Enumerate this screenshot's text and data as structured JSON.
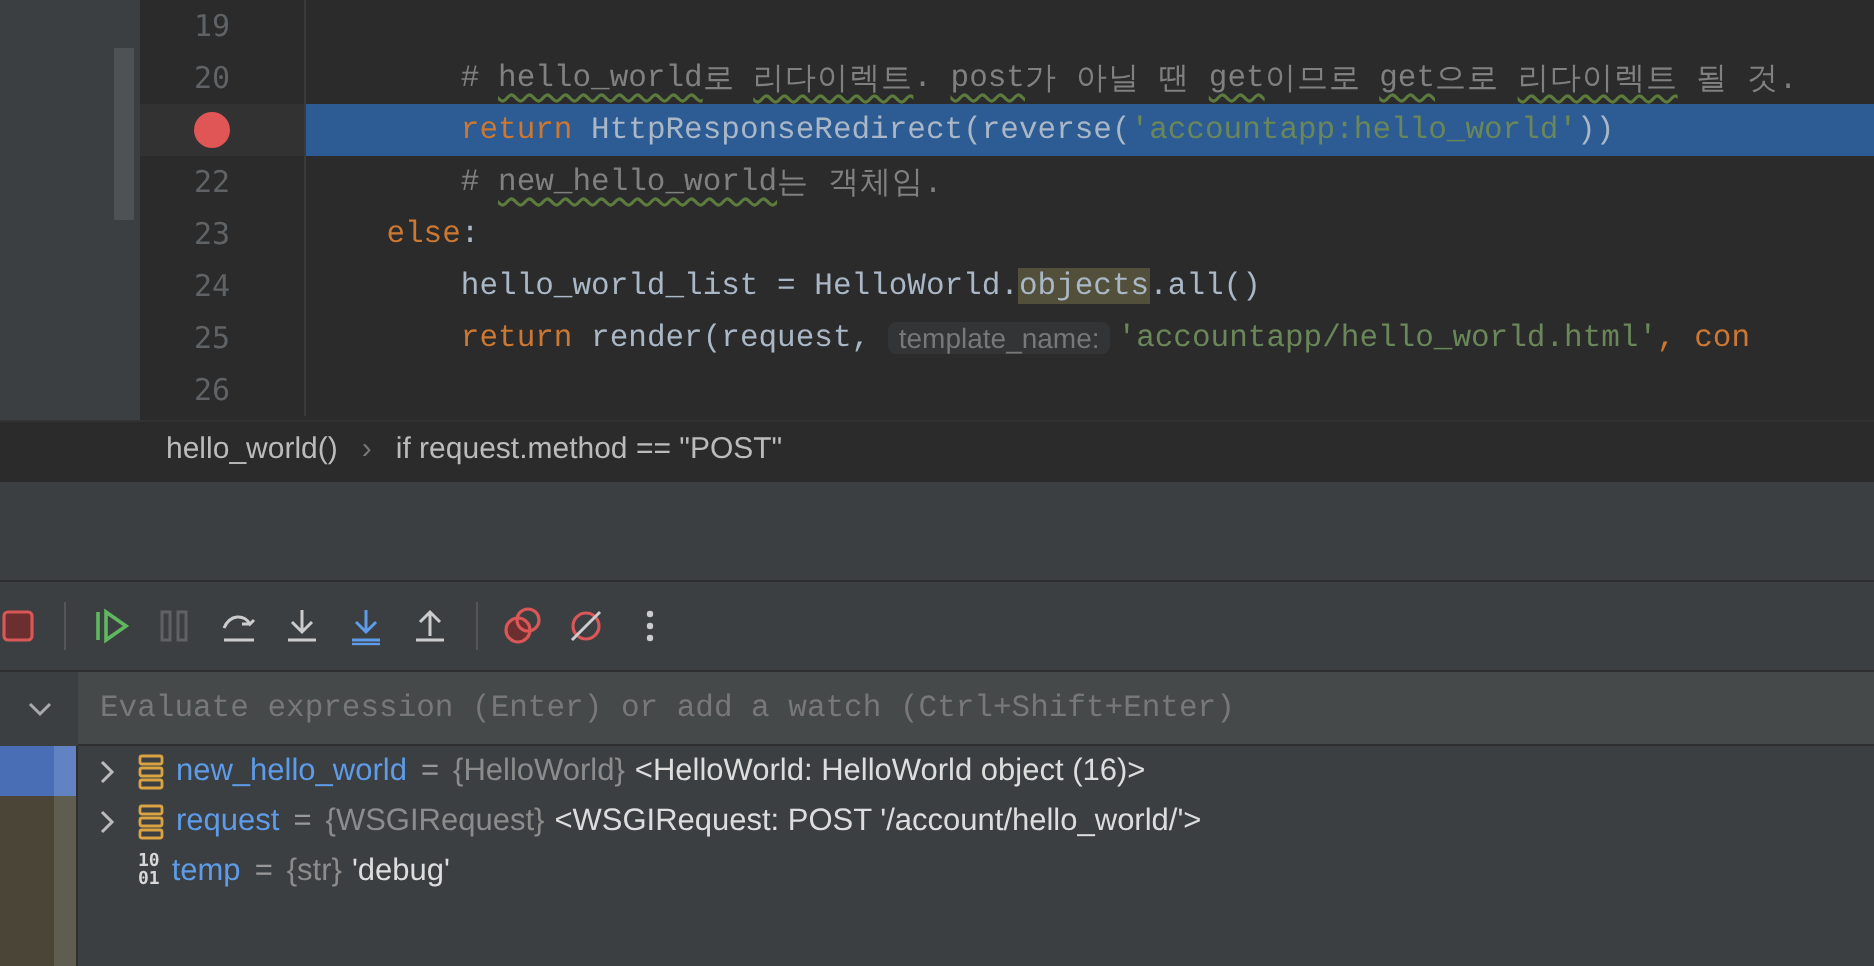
{
  "editor": {
    "lines": [
      {
        "number": "19",
        "breakpoint": false,
        "highlighted": false
      },
      {
        "number": "20",
        "breakpoint": false,
        "highlighted": false,
        "tokens": [
          {
            "text": "        # ",
            "kind": "comment"
          },
          {
            "text": "hello_world",
            "kind": "typo"
          },
          {
            "text": "로 ",
            "kind": "comment"
          },
          {
            "text": "리다이렉트",
            "kind": "typo"
          },
          {
            "text": ". ",
            "kind": "comment"
          },
          {
            "text": "post",
            "kind": "typo"
          },
          {
            "text": "가 아닐 땐 ",
            "kind": "comment"
          },
          {
            "text": "get",
            "kind": "typo"
          },
          {
            "text": "이므로 ",
            "kind": "comment"
          },
          {
            "text": "get",
            "kind": "typo"
          },
          {
            "text": "으로 ",
            "kind": "comment"
          },
          {
            "text": "리다이렉트",
            "kind": "typo"
          },
          {
            "text": " 될 것.",
            "kind": "comment"
          }
        ]
      },
      {
        "breakpoint": true,
        "highlighted": true,
        "tokens": [
          {
            "text": "        return",
            "kind": "keyword"
          },
          {
            "text": " HttpResponseRedirect(reverse(",
            "kind": "plain"
          },
          {
            "text": "'accountapp:hello_world'",
            "kind": "string"
          },
          {
            "text": "))",
            "kind": "plain"
          }
        ]
      },
      {
        "number": "22",
        "breakpoint": false,
        "highlighted": false,
        "tokens": [
          {
            "text": "        # ",
            "kind": "comment"
          },
          {
            "text": "new_hello_world",
            "kind": "typo"
          },
          {
            "text": "는 객체임.",
            "kind": "comment"
          }
        ]
      },
      {
        "number": "23",
        "breakpoint": false,
        "highlighted": false,
        "tokens": [
          {
            "text": "    else",
            "kind": "keyword"
          },
          {
            "text": ":",
            "kind": "plain"
          }
        ]
      },
      {
        "number": "24",
        "breakpoint": false,
        "highlighted": false,
        "tokens": [
          {
            "text": "        hello_world_list = HelloWorld.",
            "kind": "plain"
          },
          {
            "text": "objects",
            "kind": "marked"
          },
          {
            "text": ".all()",
            "kind": "plain"
          }
        ]
      },
      {
        "number": "25",
        "breakpoint": false,
        "highlighted": false,
        "tokens": [
          {
            "text": "        return",
            "kind": "keyword"
          },
          {
            "text": " render(request, ",
            "kind": "plain"
          },
          {
            "text": "template_name:",
            "kind": "hint"
          },
          {
            "text": "'accountapp/hello_world.html'",
            "kind": "string"
          },
          {
            "text": ", con",
            "kind": "keyword"
          }
        ]
      },
      {
        "number": "26",
        "breakpoint": false,
        "highlighted": false
      }
    ]
  },
  "breadcrumbs": [
    {
      "text": "hello_world()"
    },
    {
      "text": "if request.method == \"POST\""
    }
  ],
  "breadcrumb_separator": "›",
  "debugger": {
    "evaluate": {
      "placeholder": "Evaluate expression (Enter) or add a watch (Ctrl+Shift+Enter)"
    },
    "variables": [
      {
        "expandable": true,
        "kind": "object",
        "name": "new_hello_world",
        "sign": "=",
        "type": "{HelloWorld}",
        "value": "<HelloWorld: HelloWorld object (16)>"
      },
      {
        "expandable": true,
        "kind": "object",
        "name": "request",
        "sign": "=",
        "type": "{WSGIRequest}",
        "value": "<WSGIRequest: POST '/account/hello_world/'>"
      },
      {
        "expandable": false,
        "kind": "primitive",
        "type_badge": [
          "10",
          "01"
        ],
        "name": "temp",
        "sign": "=",
        "type": "{str}",
        "value": "'debug'"
      }
    ]
  }
}
